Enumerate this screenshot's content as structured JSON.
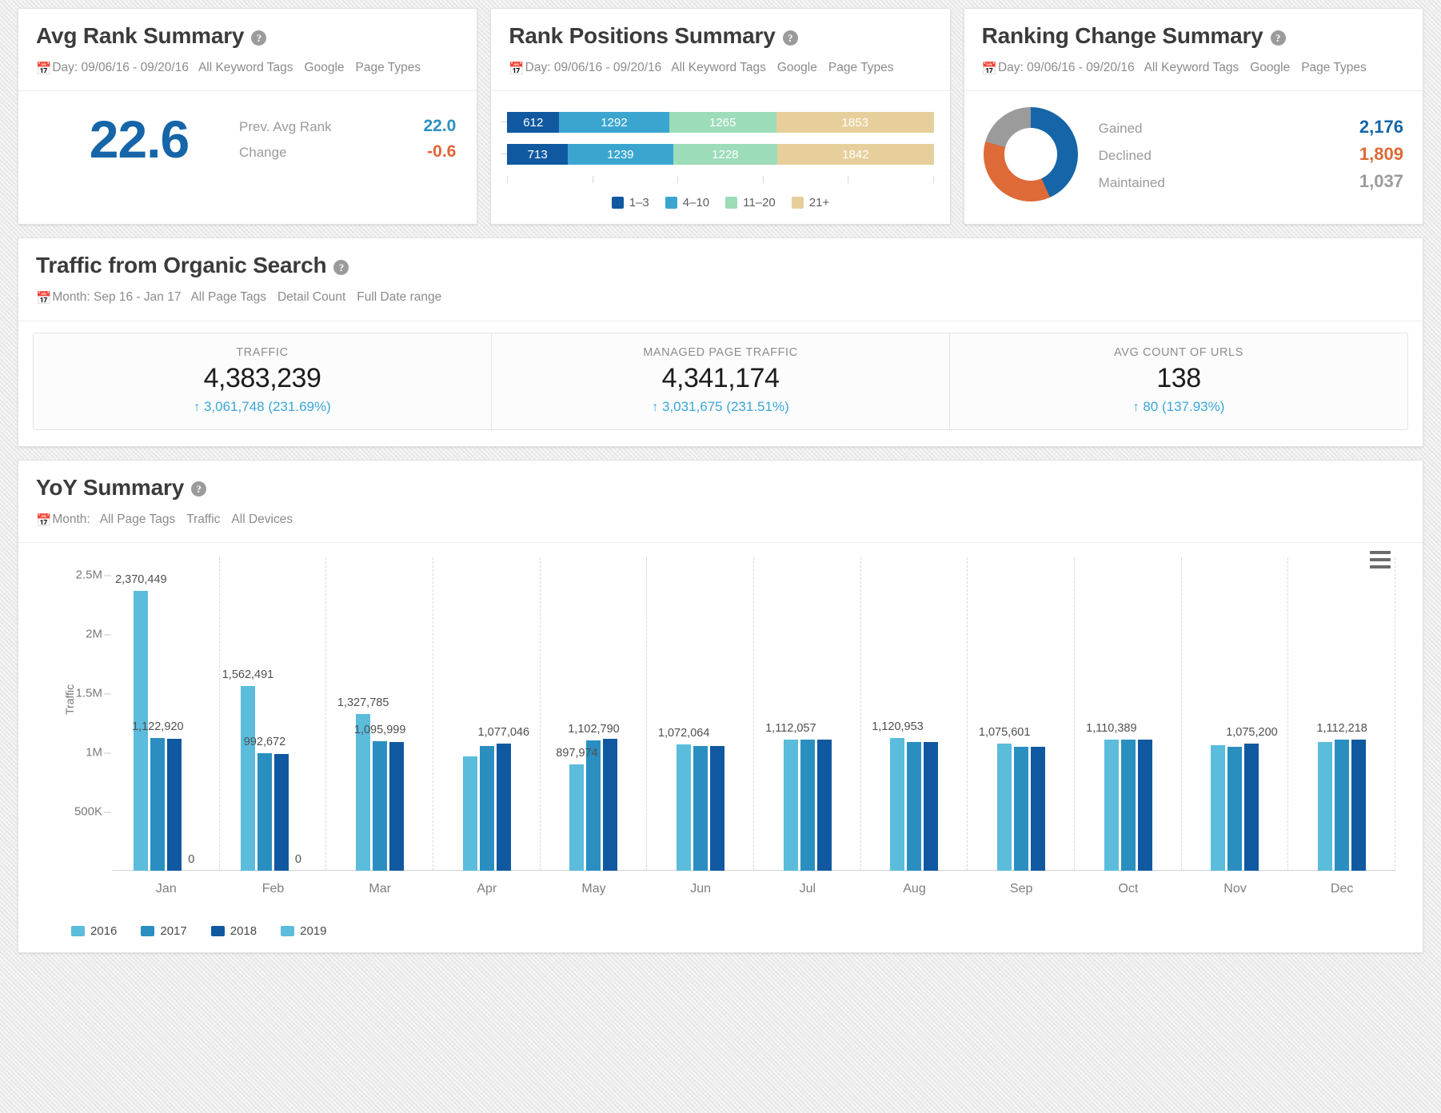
{
  "cards": {
    "avg_rank": {
      "title": "Avg Rank Summary",
      "meta": {
        "date": "Day: 09/06/16 - 09/20/16",
        "filter1": "All Keyword Tags",
        "filter2": "Google",
        "filter3": "Page Types"
      },
      "value": "22.6",
      "rows": [
        {
          "label": "Prev. Avg Rank",
          "value": "22.0",
          "tone": "blue"
        },
        {
          "label": "Change",
          "value": "-0.6",
          "tone": "orange"
        }
      ]
    },
    "rank_positions": {
      "title": "Rank Positions Summary",
      "meta": {
        "date": "Day: 09/06/16 - 09/20/16",
        "filter1": "All Keyword Tags",
        "filter2": "Google",
        "filter3": "Page Types"
      },
      "legend": [
        {
          "label": "1–3",
          "color": "#1059a0"
        },
        {
          "label": "4–10",
          "color": "#3aa6d0"
        },
        {
          "label": "11–20",
          "color": "#9ddcb9"
        },
        {
          "label": "21+",
          "color": "#e7cf9b"
        }
      ],
      "series": [
        {
          "name": "current",
          "values": [
            612,
            1292,
            1265,
            1853
          ]
        },
        {
          "name": "previous",
          "values": [
            713,
            1239,
            1228,
            1842
          ]
        }
      ]
    },
    "ranking_change": {
      "title": "Ranking Change Summary",
      "meta": {
        "date": "Day: 09/06/16 - 09/20/16",
        "filter1": "All Keyword Tags",
        "filter2": "Google",
        "filter3": "Page Types"
      },
      "rows": [
        {
          "label": "Gained",
          "value": "2,176",
          "color": "#1565a8"
        },
        {
          "label": "Declined",
          "value": "1,809",
          "color": "#dd6a37"
        },
        {
          "label": "Maintained",
          "value": "1,037",
          "color": "#9b9b9b"
        }
      ]
    }
  },
  "traffic": {
    "title": "Traffic from Organic Search",
    "meta": {
      "date": "Month: Sep 16 - Jan 17",
      "filter1": "All Page Tags",
      "filter2": "Detail Count",
      "filter3": "Full Date range"
    },
    "kpis": [
      {
        "label": "TRAFFIC",
        "value": "4,383,239",
        "delta": "3,061,748 (231.69%)",
        "arrow": "↑"
      },
      {
        "label": "MANAGED PAGE TRAFFIC",
        "value": "4,341,174",
        "delta": "3,031,675 (231.51%)",
        "arrow": "↑"
      },
      {
        "label": "AVG COUNT OF URLS",
        "value": "138",
        "delta": "80 (137.93%)",
        "arrow": "↑"
      }
    ]
  },
  "yoy": {
    "title": "YoY Summary",
    "meta": {
      "date": "Month:",
      "filter1": "All Page Tags",
      "filter2": "Traffic",
      "filter3": "All Devices"
    },
    "menu_icon": "hamburger-icon"
  },
  "chart_data": {
    "type": "bar",
    "title": "YoY Summary",
    "xlabel": "",
    "ylabel": "Traffic",
    "ylim": [
      0,
      2500000
    ],
    "yticks": [
      {
        "value": 2500000,
        "label": "2.5M"
      },
      {
        "value": 2000000,
        "label": "2M"
      },
      {
        "value": 1500000,
        "label": "1.5M"
      },
      {
        "value": 1000000,
        "label": "1M"
      },
      {
        "value": 500000,
        "label": "500K"
      }
    ],
    "grid": true,
    "legend_position": "bottom-left",
    "categories": [
      "Jan",
      "Feb",
      "Mar",
      "Apr",
      "May",
      "Jun",
      "Jul",
      "Aug",
      "Sep",
      "Oct",
      "Nov",
      "Dec"
    ],
    "series": [
      {
        "name": "2016",
        "color": "#5bbcdc",
        "values": [
          2370449,
          1562491,
          1327785,
          967000,
          897974,
          1072064,
          1112057,
          1120953,
          1075601,
          1110389,
          1065000,
          1090000
        ]
      },
      {
        "name": "2017",
        "color": "#2a8fc0",
        "values": [
          1122920,
          992672,
          1095999,
          1055000,
          1102790,
          1055000,
          1108000,
          1088000,
          1050000,
          1112000,
          1052000,
          1112218
        ]
      },
      {
        "name": "2018",
        "color": "#1059a0",
        "values": [
          1118000,
          988000,
          1088000,
          1077046,
          1120000,
          1058000,
          1108000,
          1090000,
          1050000,
          1110000,
          1075200,
          1108000
        ]
      },
      {
        "name": "2019",
        "color": "#5bbcdc",
        "values": [
          0,
          0,
          null,
          null,
          null,
          null,
          null,
          null,
          null,
          null,
          null,
          null
        ]
      }
    ],
    "point_labels": [
      {
        "category": "Jan",
        "series": "2016",
        "text": "2,370,449"
      },
      {
        "category": "Jan",
        "series": "2017",
        "text": "1,122,920"
      },
      {
        "category": "Jan",
        "series": "2019",
        "text": "0"
      },
      {
        "category": "Feb",
        "series": "2016",
        "text": "1,562,491"
      },
      {
        "category": "Feb",
        "series": "2017",
        "text": "992,672"
      },
      {
        "category": "Feb",
        "series": "2019",
        "text": "0"
      },
      {
        "category": "Mar",
        "series": "2016",
        "text": "1,327,785"
      },
      {
        "category": "Mar",
        "series": "2017",
        "text": "1,095,999"
      },
      {
        "category": "Apr",
        "series": "2018",
        "text": "1,077,046"
      },
      {
        "category": "May",
        "series": "2016",
        "text": "897,974"
      },
      {
        "category": "May",
        "series": "2017",
        "text": "1,102,790"
      },
      {
        "category": "Jun",
        "series": "2016",
        "text": "1,072,064"
      },
      {
        "category": "Jul",
        "series": "2016",
        "text": "1,112,057"
      },
      {
        "category": "Aug",
        "series": "2016",
        "text": "1,120,953"
      },
      {
        "category": "Sep",
        "series": "2016",
        "text": "1,075,601"
      },
      {
        "category": "Oct",
        "series": "2016",
        "text": "1,110,389"
      },
      {
        "category": "Nov",
        "series": "2018",
        "text": "1,075,200"
      },
      {
        "category": "Dec",
        "series": "2017",
        "text": "1,112,218"
      }
    ]
  }
}
